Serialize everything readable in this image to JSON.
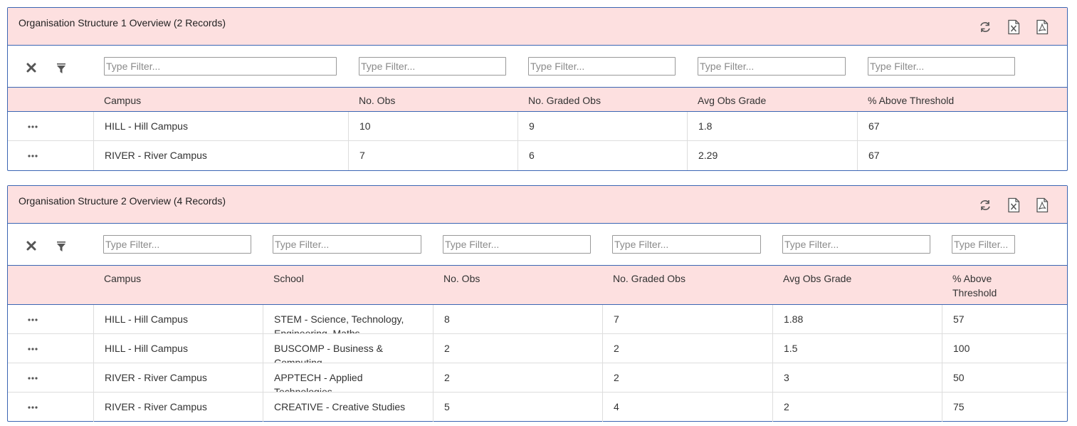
{
  "panel1": {
    "title": "Organisation Structure 1 Overview (2 Records)",
    "filter_placeholder": "Type Filter...",
    "columns": [
      "Campus",
      "No. Obs",
      "No. Graded Obs",
      "Avg Obs Grade",
      "% Above Threshold"
    ],
    "rows": [
      [
        "HILL - Hill Campus",
        "10",
        "9",
        "1.8",
        "67"
      ],
      [
        "RIVER - River Campus",
        "7",
        "6",
        "2.29",
        "67"
      ]
    ]
  },
  "panel2": {
    "title": "Organisation Structure 2 Overview (4 Records)",
    "filter_placeholder": "Type Filter...",
    "columns": [
      "Campus",
      "School",
      "No. Obs",
      "No. Graded Obs",
      "Avg Obs Grade",
      "% Above Threshold"
    ],
    "rows": [
      [
        "HILL - Hill Campus",
        "STEM - Science, Technology, Engineering, Maths",
        "8",
        "7",
        "1.88",
        "57"
      ],
      [
        "HILL - Hill Campus",
        "BUSCOMP - Business & Computing",
        "2",
        "2",
        "1.5",
        "100"
      ],
      [
        "RIVER - River Campus",
        "APPTECH - Applied Technologies",
        "2",
        "2",
        "3",
        "50"
      ],
      [
        "RIVER - River Campus",
        "CREATIVE - Creative Studies",
        "5",
        "4",
        "2",
        "75"
      ]
    ]
  },
  "icons": {
    "refresh": "refresh-icon",
    "excel": "excel-export-icon",
    "pdf": "pdf-export-icon",
    "clear": "clear-filters-icon",
    "filter": "filter-icon",
    "row_menu": "ellipsis-icon"
  },
  "colors": {
    "header_bg": "#fde0e0",
    "border": "#3b66b3",
    "row_divider": "#dddddd"
  }
}
